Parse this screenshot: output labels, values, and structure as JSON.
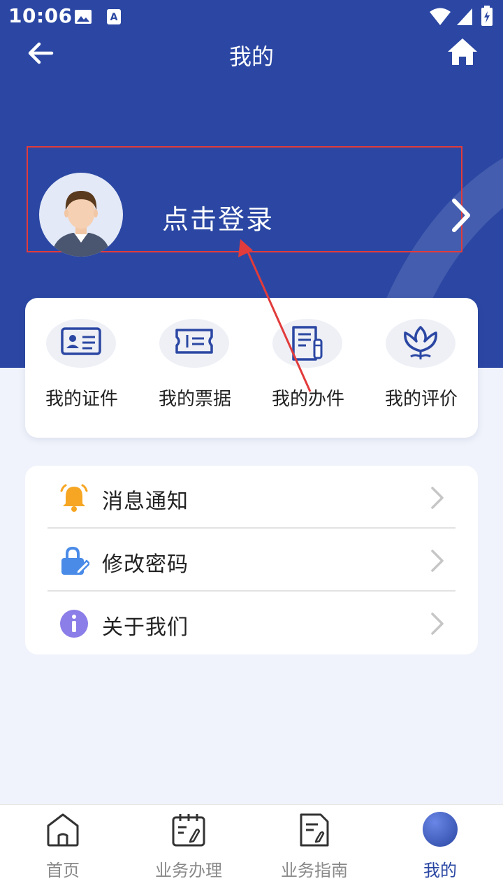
{
  "status_bar": {
    "time": "10:06"
  },
  "nav": {
    "title": "我的"
  },
  "login": {
    "label": "点击登录"
  },
  "quick_actions": [
    {
      "label": "我的证件",
      "icon": "id-card-icon"
    },
    {
      "label": "我的票据",
      "icon": "ticket-icon"
    },
    {
      "label": "我的办件",
      "icon": "document-edit-icon"
    },
    {
      "label": "我的评价",
      "icon": "flower-icon"
    }
  ],
  "menu": [
    {
      "label": "消息通知",
      "icon": "bell-icon"
    },
    {
      "label": "修改密码",
      "icon": "lock-edit-icon"
    },
    {
      "label": "关于我们",
      "icon": "info-icon"
    }
  ],
  "tabs": [
    {
      "label": "首页",
      "icon": "home-icon"
    },
    {
      "label": "业务办理",
      "icon": "calendar-edit-icon"
    },
    {
      "label": "业务指南",
      "icon": "guide-doc-icon"
    },
    {
      "label": "我的",
      "icon": "profile-ball-icon",
      "active": true
    }
  ],
  "colors": {
    "primary": "#2b47a3",
    "bell": "#f6a623",
    "lock": "#4a8be8",
    "info": "#8b7ee8",
    "annotation": "#e23b3b"
  }
}
